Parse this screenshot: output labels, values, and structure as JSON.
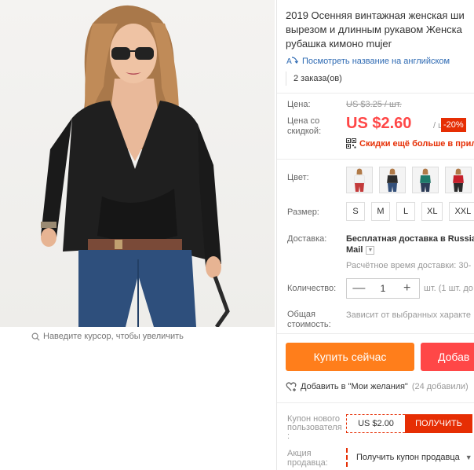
{
  "product": {
    "title_lines": [
      "2019 Осенняя винтажная женская ши",
      "вырезом и длинным рукавом Женска",
      "рубашка кимоно mujer"
    ],
    "translate_link": "Посмотреть название на английском",
    "orders": "2 заказа(ов)"
  },
  "gallery": {
    "zoom_hint": "Наведите курсор, чтобы увеличить"
  },
  "price": {
    "label": "Цена:",
    "old": "US $3.25 / шт.",
    "discount_label": "Цена со скидкой:",
    "new": "US $2.60",
    "per_unit": "/ шт.",
    "discount_badge": "-20%",
    "promo_text": "Скидки ещё больше в прило"
  },
  "options": {
    "color_label": "Цвет:",
    "colors": [
      {
        "name": "white",
        "shirt": "#f2f2f2",
        "pants": "#c33b3b"
      },
      {
        "name": "black",
        "shirt": "#2b2b2b",
        "pants": "#34507a"
      },
      {
        "name": "green",
        "shirt": "#1e7a6a",
        "pants": "#2d3c57"
      },
      {
        "name": "red",
        "shirt": "#c8202b",
        "pants": "#2a2a2a"
      }
    ],
    "size_label": "Размер:",
    "sizes": [
      "S",
      "M",
      "L",
      "XL",
      "XXL"
    ]
  },
  "shipping": {
    "label": "Доставка:",
    "main": "Бесплатная доставка в Russia",
    "carrier": "Mail",
    "time": "Расчётное время доставки: 30-"
  },
  "quantity": {
    "label": "Количество:",
    "minus": "—",
    "value": "1",
    "plus": "+",
    "note": "шт. (1 шт. до"
  },
  "total": {
    "label_line1": "Общая",
    "label_line2": "стоимость:",
    "note": "Зависит от выбранных характе"
  },
  "actions": {
    "buy_now": "Купить сейчас",
    "add_to_cart": "Добав",
    "wishlist": "Добавить в \"Мои желания\"",
    "wishlist_count": "(24 добавили)"
  },
  "coupon": {
    "label_lines": [
      "Купон нового",
      "пользователя",
      ":"
    ],
    "amount": "US $2.00",
    "get": "ПОЛУЧИТЬ"
  },
  "seller_promo": {
    "label_lines": [
      "Акция",
      "продавца:"
    ],
    "select": "Получить купон продавца"
  },
  "colors": {
    "accent_red": "#ff4747",
    "buy_orange": "#ff7e1b",
    "link_blue": "#2e6ab3",
    "badge_red": "#e62e04"
  }
}
